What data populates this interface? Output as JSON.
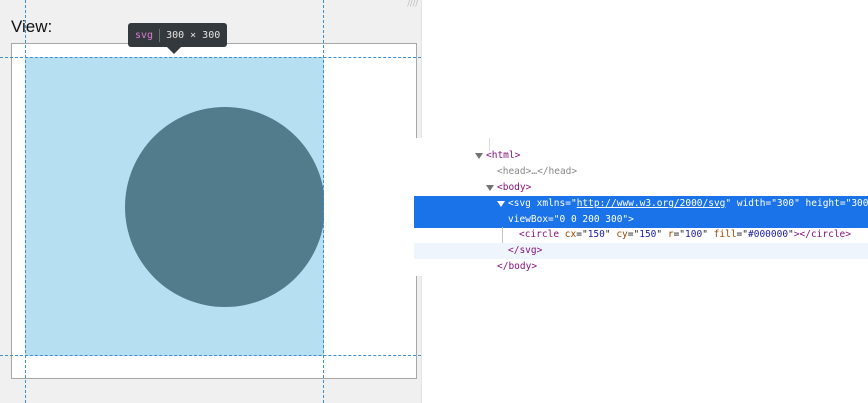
{
  "view": {
    "label": "View:",
    "resize_grip": "////"
  },
  "tooltip": {
    "tag": "svg",
    "dimensions": "300 × 300"
  },
  "rendered_svg": {
    "circle_fill": "#527b8c",
    "highlight_color": "#b6dff2"
  },
  "elements": {
    "html_open": "<html>",
    "head": {
      "open": "<head>",
      "ellipsis": "…",
      "close": "</head>"
    },
    "body_open": "<body>",
    "svg": {
      "open_tag": "<svg",
      "xmlns_attr": "xmlns",
      "xmlns_val": "http://www.w3.org/2000/svg",
      "width_attr": "width",
      "width_val": "300",
      "height_attr": "height",
      "height_val": "300",
      "viewbox_attr": "viewBox",
      "viewbox_val": "0 0 200 300",
      "close_bracket": ">",
      "close_tag": "</svg>"
    },
    "circle": {
      "open_tag": "<circle",
      "cx_attr": "cx",
      "cx_val": "150",
      "cy_attr": "cy",
      "cy_val": "150",
      "r_attr": "r",
      "r_val": "100",
      "fill_attr": "fill",
      "fill_val": "#000000",
      "close": "></circle>"
    },
    "body_close": "</body>"
  }
}
